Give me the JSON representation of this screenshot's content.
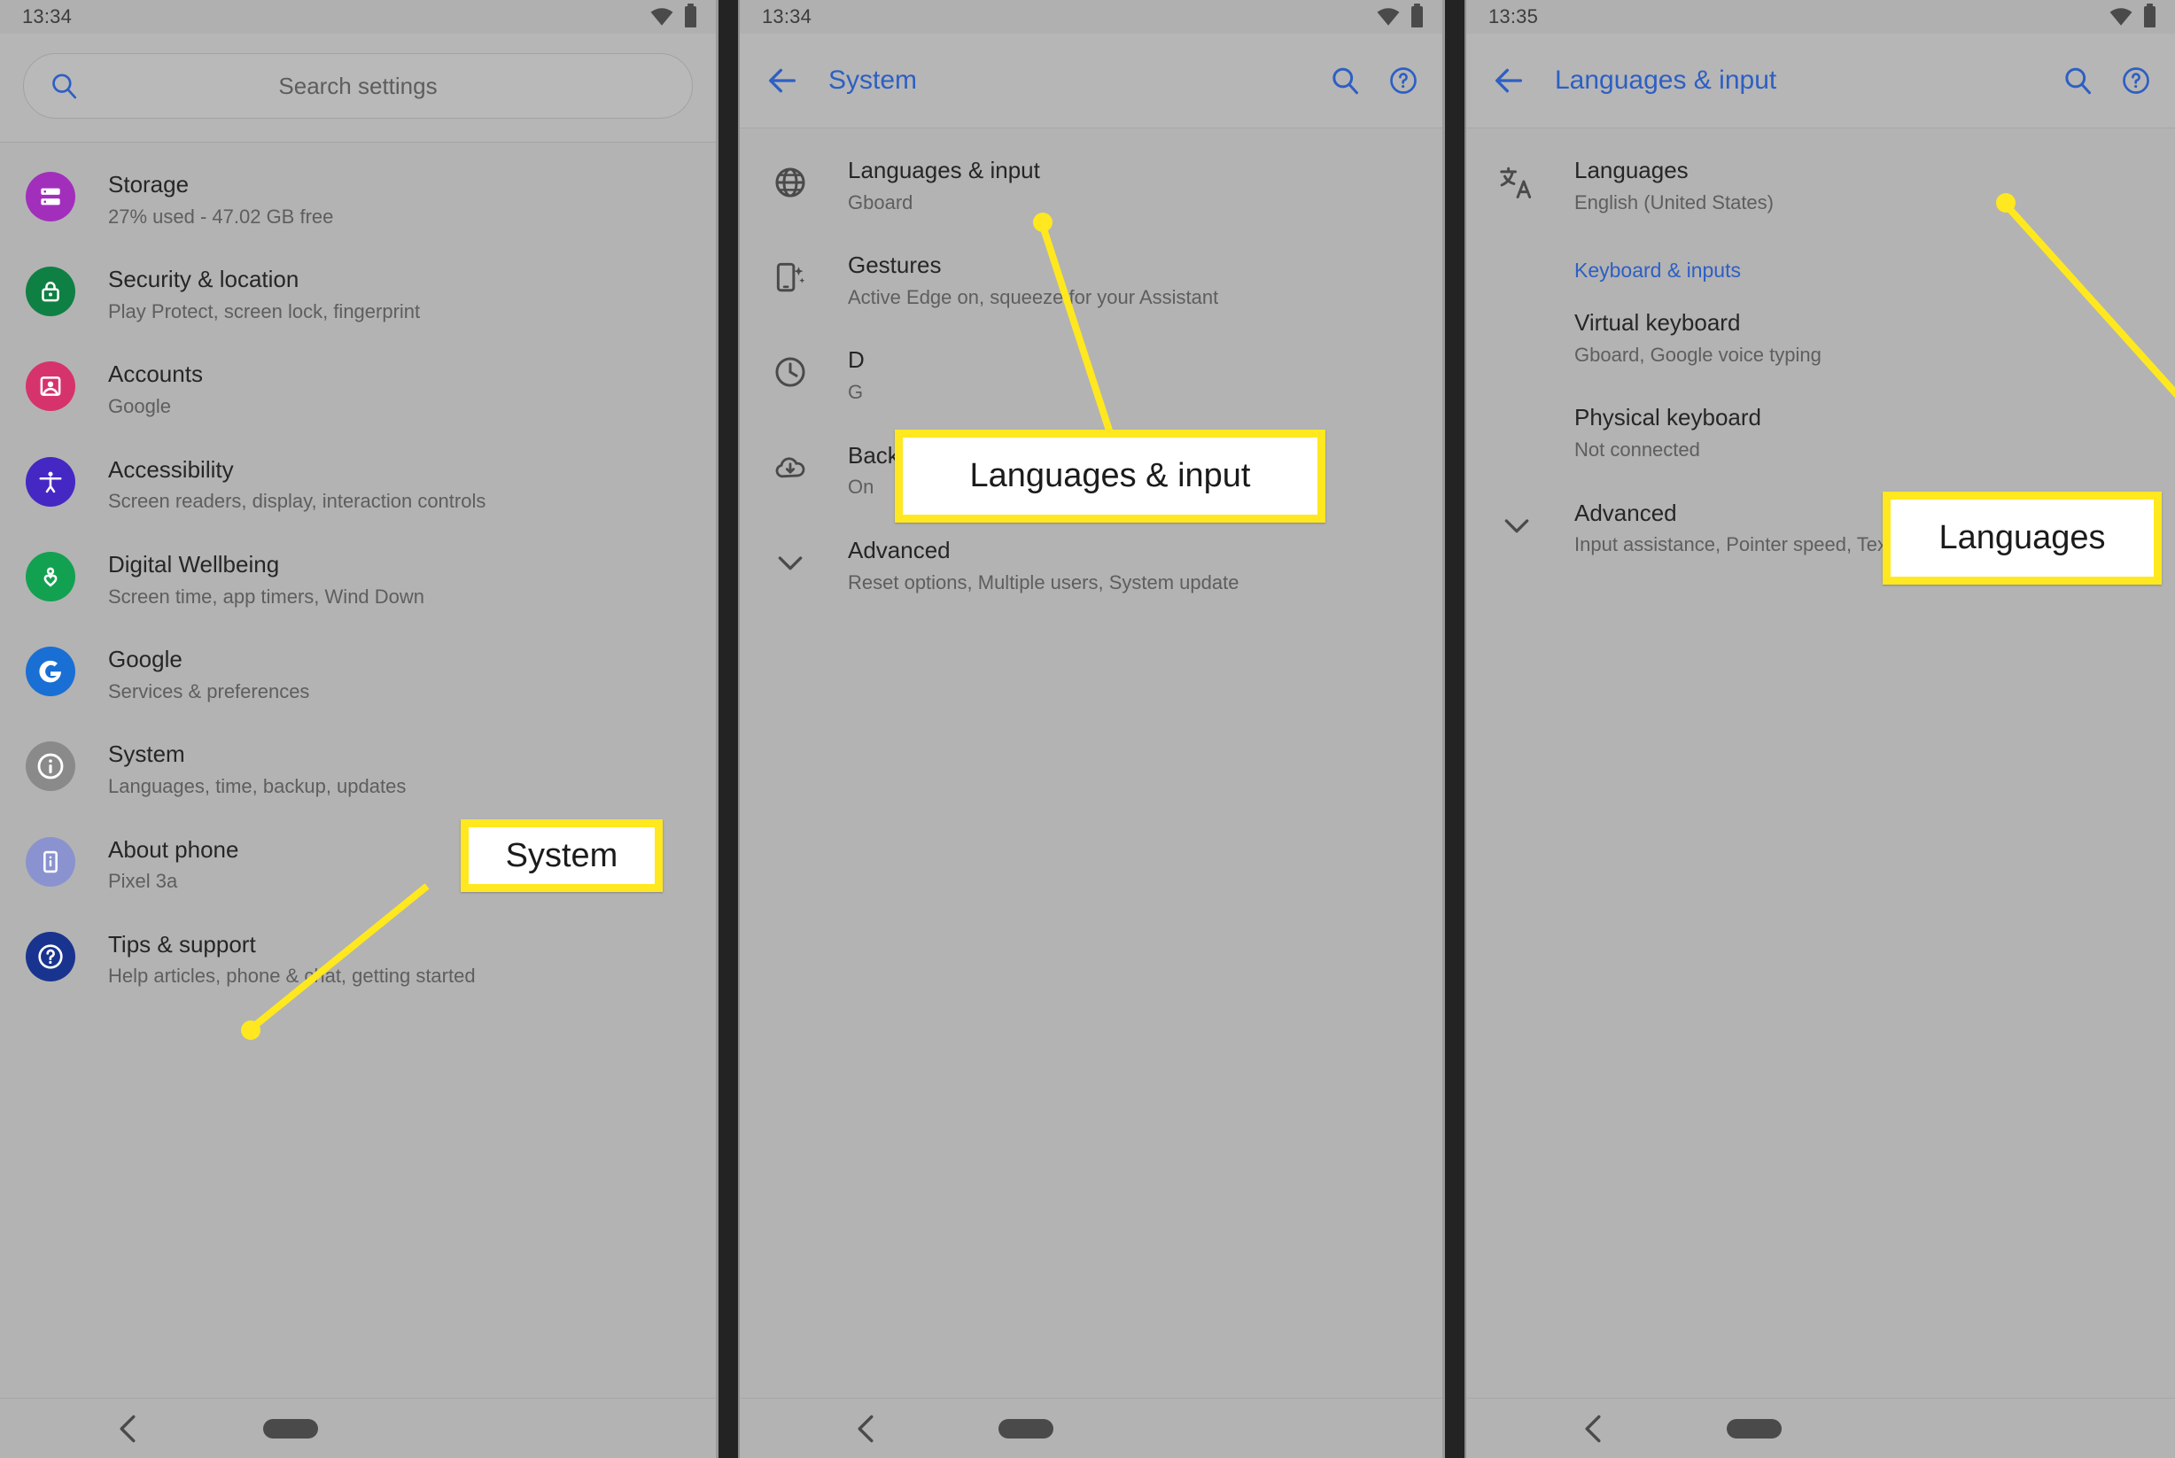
{
  "panels": [
    {
      "id": "settings-home",
      "statusbar": {
        "time": "13:34",
        "wifi_icon": "wifi-icon",
        "battery_icon": "battery-icon"
      },
      "search": {
        "icon": "search-icon",
        "placeholder": "Search settings"
      },
      "items": [
        {
          "title": "Storage",
          "subtitle": "27% used - 47.02 GB free",
          "icon": "storage-icon",
          "color": "#a22fbc"
        },
        {
          "title": "Security & location",
          "subtitle": "Play Protect, screen lock, fingerprint",
          "icon": "lock-icon",
          "color": "#0f8043"
        },
        {
          "title": "Accounts",
          "subtitle": "Google",
          "icon": "account-icon",
          "color": "#d6336c"
        },
        {
          "title": "Accessibility",
          "subtitle": "Screen readers, display, interaction controls",
          "icon": "accessibility-icon",
          "color": "#4527c4"
        },
        {
          "title": "Digital Wellbeing",
          "subtitle": "Screen time, app timers, Wind Down",
          "icon": "wellbeing-icon",
          "color": "#12a150"
        },
        {
          "title": "Google",
          "subtitle": "Services & preferences",
          "icon": "google-g-icon",
          "color": "#1a6fd4"
        },
        {
          "title": "System",
          "subtitle": "Languages, time, backup, updates",
          "icon": "info-circle-icon",
          "color": "#8a8a8a"
        },
        {
          "title": "About phone",
          "subtitle": "Pixel 3a",
          "icon": "phone-info-icon",
          "color": "#8a93cf"
        },
        {
          "title": "Tips & support",
          "subtitle": "Help articles, phone & chat, getting started",
          "icon": "help-circle-icon",
          "color": "#19348f"
        }
      ],
      "navbar": {
        "back_icon": "nav-back-icon",
        "home_icon": "nav-home-pill-icon"
      }
    },
    {
      "id": "system",
      "statusbar": {
        "time": "13:34",
        "wifi_icon": "wifi-icon",
        "battery_icon": "battery-icon"
      },
      "appbar": {
        "back_icon": "back-arrow-icon",
        "title": "System",
        "search_icon": "search-icon",
        "help_icon": "help-circle-icon"
      },
      "items": [
        {
          "title": "Languages & input",
          "subtitle": "Gboard",
          "icon": "globe-icon"
        },
        {
          "title": "Gestures",
          "subtitle": "Active Edge on, squeeze for your Assistant",
          "icon": "gesture-phone-icon"
        },
        {
          "title": "D",
          "subtitle": "G",
          "icon": "clock-icon"
        },
        {
          "title": "Backup",
          "subtitle": "On",
          "icon": "backup-cloud-icon"
        },
        {
          "title": "Advanced",
          "subtitle": "Reset options, Multiple users, System update",
          "icon": "chevron-down-icon"
        }
      ],
      "navbar": {
        "back_icon": "nav-back-icon",
        "home_icon": "nav-home-pill-icon"
      }
    },
    {
      "id": "languages-and-input",
      "statusbar": {
        "time": "13:35",
        "wifi_icon": "wifi-icon",
        "battery_icon": "battery-icon"
      },
      "appbar": {
        "back_icon": "back-arrow-icon",
        "title": "Languages & input",
        "search_icon": "search-icon",
        "help_icon": "help-circle-icon"
      },
      "items_top": [
        {
          "title": "Languages",
          "subtitle": "English (United States)",
          "icon": "translate-icon"
        }
      ],
      "section_header": "Keyboard & inputs",
      "items": [
        {
          "title": "Virtual keyboard",
          "subtitle": "Gboard, Google voice typing",
          "icon": "none"
        },
        {
          "title": "Physical keyboard",
          "subtitle": "Not connected",
          "icon": "none"
        },
        {
          "title": "Advanced",
          "subtitle": "Input assistance, Pointer speed, Text-to-speech..",
          "icon": "chevron-down-icon"
        }
      ],
      "navbar": {
        "back_icon": "nav-back-icon",
        "home_icon": "nav-home-pill-icon"
      }
    }
  ],
  "annotations": [
    {
      "label": "System",
      "panel": 1
    },
    {
      "label": "Languages & input",
      "panel": 2
    },
    {
      "label": "Languages",
      "panel": 3
    }
  ],
  "theme": {
    "highlight": "#ffe81f",
    "accent_blue": "#2d5fc4",
    "panel_bg": "#b3b3b3"
  }
}
